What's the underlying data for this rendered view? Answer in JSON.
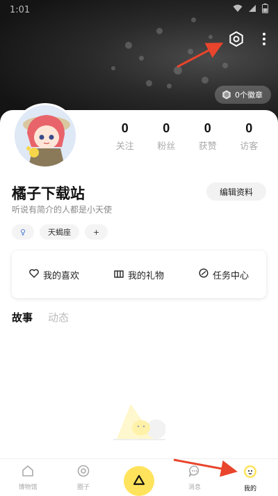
{
  "status_bar": {
    "time": "1:01"
  },
  "header": {
    "badge_label": "0个徽章"
  },
  "profile": {
    "name": "橘子下载站",
    "bio": "听说有简介的人都是小天使",
    "edit_label": "编辑资料",
    "stats": [
      {
        "value": "0",
        "label": "关注"
      },
      {
        "value": "0",
        "label": "粉丝"
      },
      {
        "value": "0",
        "label": "获赞"
      },
      {
        "value": "0",
        "label": "访客"
      }
    ],
    "tags": {
      "gender": "♀",
      "zodiac": "天蝎座",
      "add": "+"
    }
  },
  "features": [
    {
      "label": "我的喜欢",
      "icon": "heart-icon"
    },
    {
      "label": "我的礼物",
      "icon": "gift-icon"
    },
    {
      "label": "任务中心",
      "icon": "task-icon"
    }
  ],
  "content_tabs": [
    {
      "label": "故事",
      "active": true
    },
    {
      "label": "动态",
      "active": false
    }
  ],
  "bottom_nav": [
    {
      "label": "博物馆",
      "icon": "home-icon"
    },
    {
      "label": "圈子",
      "icon": "circle-icon"
    },
    {
      "label": "",
      "icon": "create-icon"
    },
    {
      "label": "消息",
      "icon": "message-icon"
    },
    {
      "label": "我的",
      "icon": "profile-icon",
      "active": true
    }
  ],
  "colors": {
    "accent": "#ffe35c",
    "annotation": "#e8452c",
    "header_dark": "#1e1e1e"
  }
}
